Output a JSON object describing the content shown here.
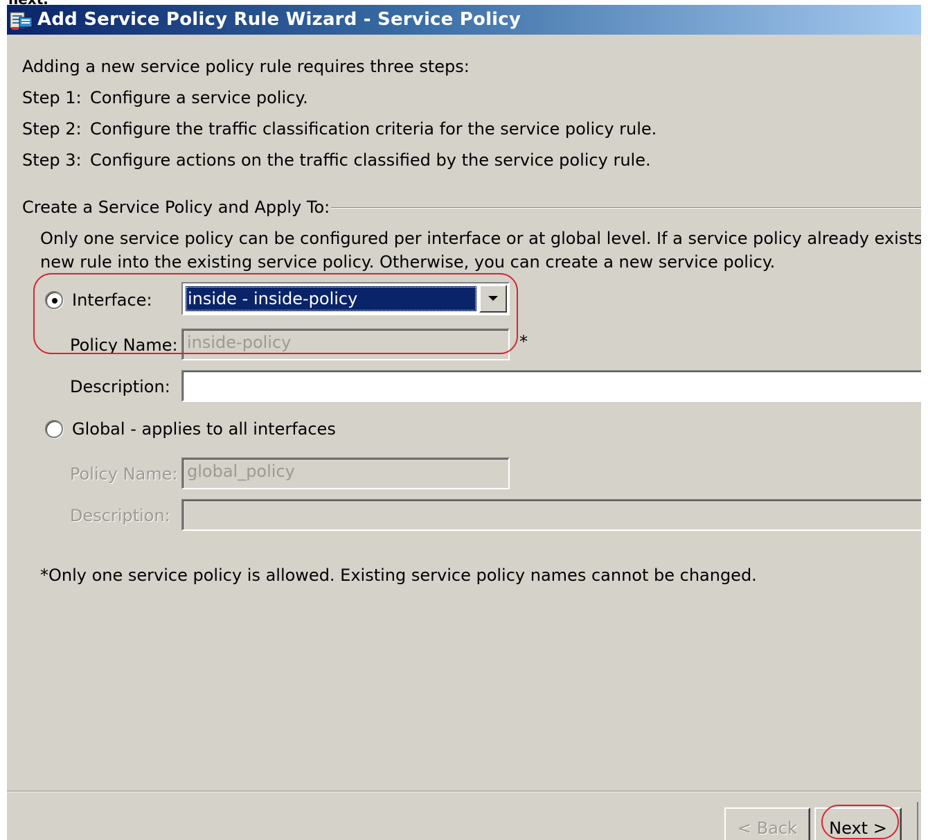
{
  "page": {
    "top_cut_text": "next."
  },
  "window": {
    "title": "Add Service Policy Rule Wizard - Service Policy",
    "icon": "wizard-app-icon"
  },
  "intro": {
    "heading": "Adding a new service policy rule requires three steps:",
    "steps": [
      {
        "label": "Step 1:",
        "text": "Configure a service policy."
      },
      {
        "label": "Step 2:",
        "text": "Configure the traffic classification criteria for the service policy rule."
      },
      {
        "label": "Step 3:",
        "text": "Configure actions on the traffic classified by the service policy rule."
      }
    ]
  },
  "group": {
    "title": "Create a Service Policy and Apply To:",
    "note_line1": "Only one service policy can be configured per interface or at global level. If a service policy already exists, then",
    "note_line2": "new rule into the existing service policy. Otherwise, you can create a new service policy."
  },
  "interface_option": {
    "radio_label": "Interface:",
    "selected": true,
    "combo_value": "inside - inside-policy",
    "policy_name_label": "Policy Name:",
    "policy_name_value": "inside-policy",
    "required_marker": "*",
    "description_label": "Description:",
    "description_value": ""
  },
  "global_option": {
    "radio_label": "Global - applies to all interfaces",
    "selected": false,
    "policy_name_label": "Policy Name:",
    "policy_name_value": "global_policy",
    "description_label": "Description:",
    "description_value": ""
  },
  "footnote": "*Only one service policy is allowed. Existing service policy names cannot be changed.",
  "buttons": {
    "back": "< Back",
    "next": "Next >"
  },
  "colors": {
    "highlight": "#d6262e",
    "selection": "#0a246a",
    "dialog_bg": "#d5d2ca"
  }
}
